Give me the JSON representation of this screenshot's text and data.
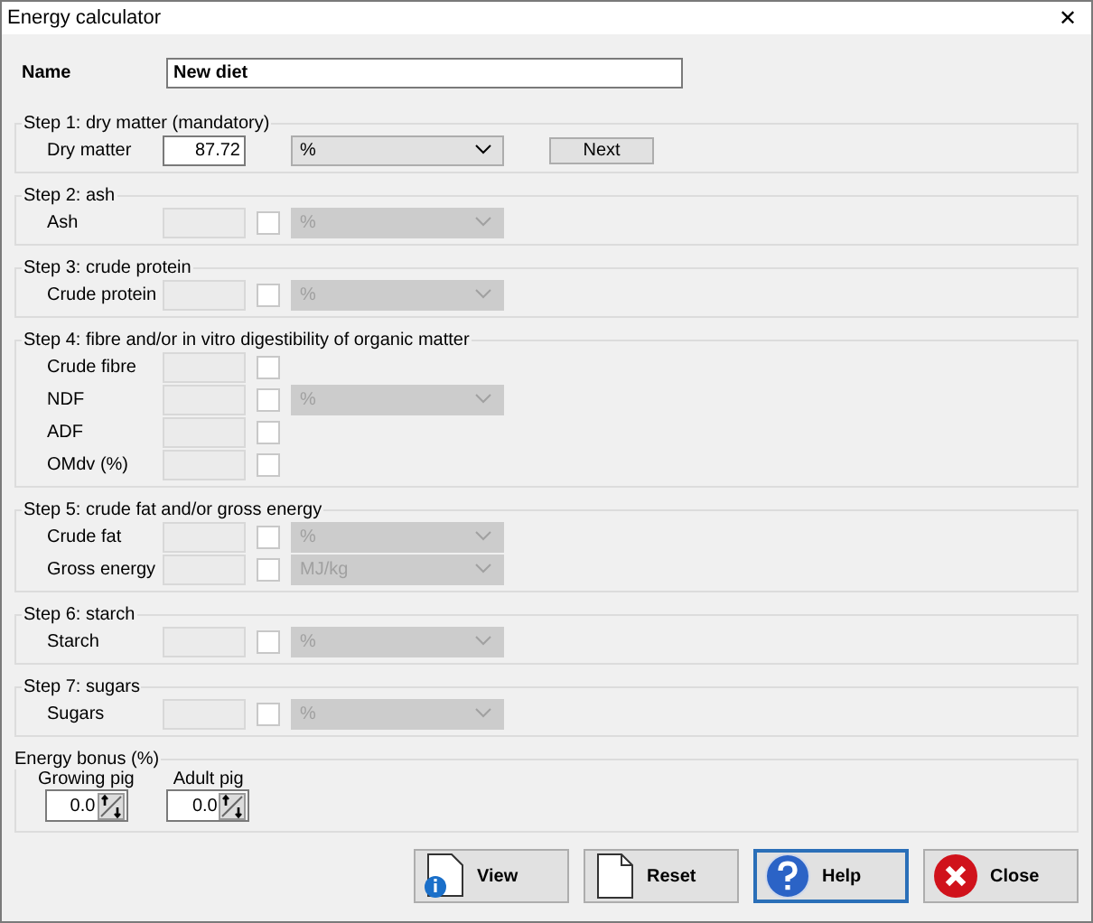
{
  "window": {
    "title": "Energy calculator",
    "close": "✕"
  },
  "name": {
    "label": "Name",
    "value": "New diet"
  },
  "steps": [
    {
      "title": "Step 1: dry matter (mandatory)",
      "next": "Next",
      "rows": [
        {
          "label": "Dry matter",
          "value": "87.72",
          "unit": "%",
          "disabled": false
        }
      ]
    },
    {
      "title": "Step 2: ash",
      "rows": [
        {
          "label": "Ash",
          "checked": false,
          "unit": "%",
          "disabled": true
        }
      ]
    },
    {
      "title": "Step 3: crude protein",
      "rows": [
        {
          "label": "Crude protein",
          "checked": false,
          "unit": "%",
          "disabled": true
        }
      ]
    },
    {
      "title": "Step 4: fibre and/or in vitro digestibility of organic matter",
      "rows": [
        {
          "label": "Crude fibre",
          "checked": false,
          "disabled": true
        },
        {
          "label": "NDF",
          "checked": false,
          "unit": "%",
          "disabled": true
        },
        {
          "label": "ADF",
          "checked": false,
          "disabled": true
        },
        {
          "label": "OMdv (%)",
          "checked": false,
          "disabled": true
        }
      ]
    },
    {
      "title": "Step 5: crude fat and/or gross energy",
      "rows": [
        {
          "label": "Crude fat",
          "checked": false,
          "unit": "%",
          "disabled": true
        },
        {
          "label": "Gross energy",
          "checked": false,
          "unit": "MJ/kg",
          "disabled": true
        }
      ]
    },
    {
      "title": "Step 6: starch",
      "rows": [
        {
          "label": "Starch",
          "checked": false,
          "unit": "%",
          "disabled": true
        }
      ]
    },
    {
      "title": "Step 7: sugars",
      "rows": [
        {
          "label": "Sugars",
          "checked": false,
          "unit": "%",
          "disabled": true
        }
      ]
    }
  ],
  "bonus": {
    "title": "Energy bonus (%)",
    "fields": [
      {
        "label": "Growing pig",
        "value": "0.0"
      },
      {
        "label": "Adult pig",
        "value": "0.0"
      }
    ]
  },
  "buttons": [
    {
      "kind": "view",
      "label": "View",
      "focused": false
    },
    {
      "kind": "reset",
      "label": "Reset",
      "focused": false
    },
    {
      "kind": "help",
      "label": "Help",
      "focused": true
    },
    {
      "kind": "close",
      "label": "Close",
      "focused": false
    }
  ]
}
